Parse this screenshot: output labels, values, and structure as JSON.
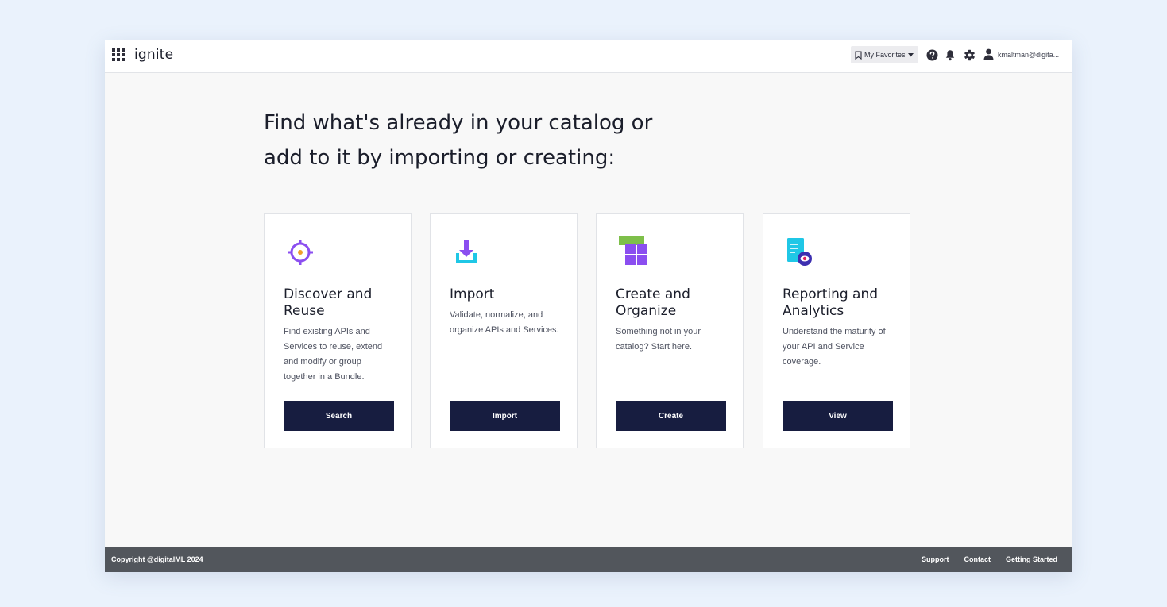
{
  "header": {
    "logo": "ignite",
    "favorites_label": "My Favorites",
    "user_email": "kmaltman@digita..."
  },
  "main": {
    "headline_line1": "Find what's already in your catalog or",
    "headline_line2": "add to it by importing or creating:",
    "cards": [
      {
        "title_line1": "Discover and",
        "title_line2": "Reuse",
        "description": "Find existing APIs and Services to reuse, extend and modify or group together in a Bundle.",
        "button": "Search",
        "icon": "target-icon"
      },
      {
        "title_line1": "Import",
        "title_line2": "",
        "description": "Validate, normalize, and organize APIs and Services.",
        "button": "Import",
        "icon": "import-download-icon"
      },
      {
        "title_line1": "Create and",
        "title_line2": "Organize",
        "description": "Something not in your catalog? Start here.",
        "button": "Create",
        "icon": "blocks-grid-icon"
      },
      {
        "title_line1": "Reporting and",
        "title_line2": "Analytics",
        "description": "Understand the maturity of your API and Service coverage.",
        "button": "View",
        "icon": "report-document-icon"
      }
    ]
  },
  "footer": {
    "copyright": "Copyright @digitalML 2024",
    "links": [
      "Support",
      "Contact",
      "Getting Started"
    ]
  },
  "colors": {
    "page_background": "#eaf2fc",
    "primary_button": "#171d40",
    "footer_background": "#52565c",
    "accent_purple": "#8b4ef0",
    "accent_orange": "#f0a02a",
    "accent_cyan": "#1fc7e6",
    "accent_green": "#7ebf4a"
  }
}
